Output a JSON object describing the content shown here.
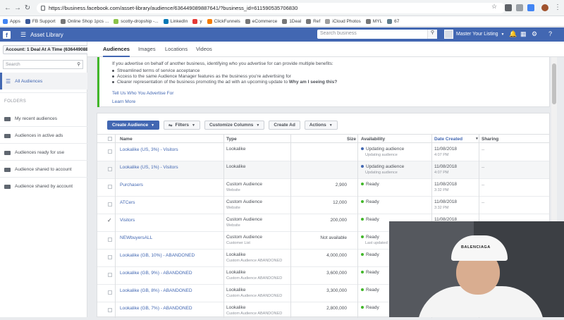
{
  "browser": {
    "url": "https://business.facebook.com/asset-library/audience/636449089887641/?business_id=611590535706830",
    "bookmarks": [
      "Apps",
      "FB Support",
      "Online Shop 1pcs ...",
      "scotty-dropship -...",
      "LinkedIn",
      "y",
      "ClickFunnels",
      "eCommerce",
      "1Deal",
      "Ref",
      "iCloud Photos",
      "MYL",
      "67"
    ]
  },
  "fbbar": {
    "title": "Asset Library",
    "search_placeholder": "Search business",
    "account": "Master Your Listing"
  },
  "sidebar": {
    "account_selector": "Account: 1 Deal At A Time (636449088...",
    "search_placeholder": "Search",
    "all_audiences": "All Audiences",
    "folders_header": "FOLDERS",
    "folders": [
      "My recent audiences",
      "Audiences in active ads",
      "Audiences ready for use",
      "Audience shared to account",
      "Audience shared by account"
    ]
  },
  "tabs": [
    "Audiences",
    "Images",
    "Locations",
    "Videos"
  ],
  "info": {
    "intro": "If you advertise on behalf of another business, identifying who you advertise for can provide multiple benefits:",
    "bullets": [
      "Streamlined terms of service acceptance",
      "Access to the same Audience Manager features as the business you're advertising for",
      "Clearer representation of the business promoting the ad with an upcoming update to "
    ],
    "why_link": "Why am I seeing this?",
    "tell_us": "Tell Us Who You Advertise For",
    "learn_more": "Learn More"
  },
  "toolbar": {
    "create_audience": "Create Audience",
    "filters": "Filters",
    "customize_columns": "Customize Columns",
    "create_ad": "Create Ad",
    "actions": "Actions"
  },
  "columns": {
    "name": "Name",
    "type": "Type",
    "size": "Size",
    "availability": "Availability",
    "date_created": "Date Created",
    "sharing": "Sharing"
  },
  "rows": [
    {
      "name": "Lookalike (US, 3%) - Visitors",
      "type": "Lookalike",
      "sub": "",
      "size": "",
      "avail": "Updating audience",
      "avail_sub": "Updating audience",
      "dot": "#4267b2",
      "date": "11/08/2018",
      "time": "4:07 PM",
      "sharing": "--",
      "checked": false
    },
    {
      "name": "Lookalike (US, 1%) - Visitors",
      "type": "Lookalike",
      "sub": "",
      "size": "",
      "avail": "Updating audience",
      "avail_sub": "Updating audience",
      "dot": "#4267b2",
      "date": "11/08/2018",
      "time": "4:07 PM",
      "sharing": "--",
      "checked": false
    },
    {
      "name": "Purchasers",
      "type": "Custom Audience",
      "sub": "Website",
      "size": "2,900",
      "avail": "Ready",
      "avail_sub": "",
      "dot": "#42b72a",
      "date": "11/08/2018",
      "time": "3:32 PM",
      "sharing": "--",
      "checked": false
    },
    {
      "name": "ATCers",
      "type": "Custom Audience",
      "sub": "Website",
      "size": "12,000",
      "avail": "Ready",
      "avail_sub": "",
      "dot": "#42b72a",
      "date": "11/08/2018",
      "time": "3:32 PM",
      "sharing": "--",
      "checked": false
    },
    {
      "name": "Visitors",
      "type": "Custom Audience",
      "sub": "Website",
      "size": "200,000",
      "avail": "Ready",
      "avail_sub": "",
      "dot": "#42b72a",
      "date": "11/08/2018",
      "time": "",
      "sharing": "",
      "checked": true
    },
    {
      "name": "NEWbuyersALL",
      "type": "Custom Audience",
      "sub": "Customer List",
      "size": "Not available",
      "avail": "Ready",
      "avail_sub": "Last updated",
      "dot": "#42b72a",
      "date": "",
      "time": "",
      "sharing": "",
      "checked": false
    },
    {
      "name": "Lookalike (GB, 10%) - ABANDONED",
      "type": "Lookalike",
      "sub": "Custom Audience ABANDONED",
      "size": "4,000,000",
      "avail": "Ready",
      "avail_sub": "",
      "dot": "#42b72a",
      "date": "",
      "time": "",
      "sharing": "",
      "checked": false
    },
    {
      "name": "Lookalike (GB, 9%) - ABANDONED",
      "type": "Lookalike",
      "sub": "Custom Audience ABANDONED",
      "size": "3,600,000",
      "avail": "Ready",
      "avail_sub": "",
      "dot": "#42b72a",
      "date": "",
      "time": "",
      "sharing": "",
      "checked": false
    },
    {
      "name": "Lookalike (GB, 8%) - ABANDONED",
      "type": "Lookalike",
      "sub": "Custom Audience ABANDONED",
      "size": "3,300,000",
      "avail": "Ready",
      "avail_sub": "",
      "dot": "#42b72a",
      "date": "",
      "time": "",
      "sharing": "",
      "checked": false
    },
    {
      "name": "Lookalike (GB, 7%) - ABANDONED",
      "type": "Lookalike",
      "sub": "Custom Audience ABANDONED",
      "size": "2,800,000",
      "avail": "Ready",
      "avail_sub": "",
      "dot": "#42b72a",
      "date": "",
      "time": "",
      "sharing": "",
      "checked": false
    }
  ],
  "webcam": {
    "cap_text": "BALENCIAGA"
  }
}
